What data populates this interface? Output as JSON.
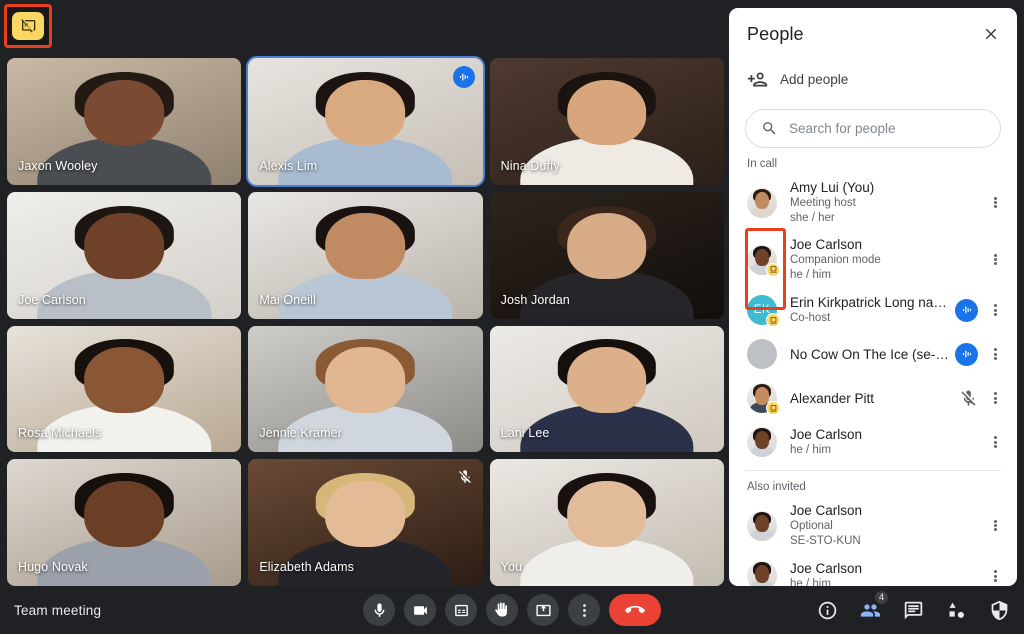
{
  "meeting": {
    "title": "Team meeting",
    "corner_badge_icon": "present-off-icon"
  },
  "grid": {
    "tiles": [
      {
        "name": "Jaxon Wooley",
        "speaking": false,
        "muted": false,
        "skin": "#7a4a33",
        "hair": "#241a14",
        "shirt": "#4a4d52",
        "bg1": "#c9b9a6",
        "bg2": "#8f8170"
      },
      {
        "name": "Alexis Lim",
        "speaking": true,
        "muted": false,
        "skin": "#d9a97f",
        "hair": "#1c1410",
        "shirt": "#a8bbd0",
        "bg1": "#e7e4df",
        "bg2": "#c5bfb5"
      },
      {
        "name": "Nina Duffy",
        "speaking": false,
        "muted": false,
        "skin": "#d7a67c",
        "hair": "#1b1310",
        "shirt": "#efeae4",
        "bg1": "#4e3a30",
        "bg2": "#2a1f19"
      },
      {
        "name": "Joe Carlson",
        "speaking": false,
        "muted": false,
        "skin": "#6e4128",
        "hair": "#1d1511",
        "shirt": "#b9bfc6",
        "bg1": "#efeeec",
        "bg2": "#d4d0c9"
      },
      {
        "name": "Mai Oneill",
        "speaking": false,
        "muted": false,
        "skin": "#c08b63",
        "hair": "#1a1210",
        "shirt": "#b9c6d4",
        "bg1": "#e9e7e3",
        "bg2": "#b9b4ab"
      },
      {
        "name": "Josh Jordan",
        "speaking": false,
        "muted": false,
        "skin": "#d8ab87",
        "hair": "#3a261a",
        "shirt": "#26262a",
        "bg1": "#2d241d",
        "bg2": "#120e0b"
      },
      {
        "name": "Rosa Michaels",
        "speaking": false,
        "muted": false,
        "skin": "#8a5736",
        "hair": "#17110d",
        "shirt": "#f2f1ee",
        "bg1": "#e6e2da",
        "bg2": "#b9a893"
      },
      {
        "name": "Jennie Kramer",
        "speaking": false,
        "muted": false,
        "skin": "#e0b693",
        "hair": "#8a5a34",
        "shirt": "#cfd6dd",
        "bg1": "#cfcdc9",
        "bg2": "#8d8b87"
      },
      {
        "name": "Lani Lee",
        "speaking": false,
        "muted": false,
        "skin": "#dcb08a",
        "hair": "#15100d",
        "shirt": "#2a3148",
        "bg1": "#eceae6",
        "bg2": "#cfc9c0"
      },
      {
        "name": "Hugo Novak",
        "speaking": false,
        "muted": false,
        "skin": "#6b3f26",
        "hair": "#15100c",
        "shirt": "#9aa1ab",
        "bg1": "#ddd8d1",
        "bg2": "#a89b8b"
      },
      {
        "name": "Elizabeth Adams",
        "speaking": false,
        "muted": true,
        "skin": "#e3bb97",
        "hair": "#d6b679",
        "shirt": "#24242a",
        "bg1": "#6a4a36",
        "bg2": "#2c1d14"
      },
      {
        "name": "You",
        "speaking": false,
        "muted": false,
        "skin": "#e2bc9a",
        "hair": "#191110",
        "shirt": "#f0eeea",
        "bg1": "#ebe8e3",
        "bg2": "#c3bcb1"
      }
    ]
  },
  "people_panel": {
    "title": "People",
    "close_label": "Close",
    "add_people_label": "Add people",
    "search": {
      "value": "",
      "placeholder": "Search for people"
    },
    "sections": [
      {
        "label": "In call",
        "people": [
          {
            "name": "Amy Lui (You)",
            "sub1": "Meeting host",
            "sub2": "she / her",
            "avatar_type": "photo",
            "skin": "#c08b63",
            "hair": "#2a1a12",
            "shirt": "#dcd6cd",
            "companion": false,
            "audio_active": false,
            "muted": false
          },
          {
            "name": "Joe Carlson",
            "sub1": "Companion mode",
            "sub2": "he / him",
            "avatar_type": "photo",
            "skin": "#6e4128",
            "hair": "#1d1511",
            "shirt": "#cfd3d8",
            "companion": true,
            "audio_active": false,
            "muted": false
          },
          {
            "name": "Erin Kirkpatrick Long nam…",
            "sub1": "Co-host",
            "sub2": "",
            "avatar_type": "initials",
            "initials": "EK",
            "avatar_color": "#3fbcd1",
            "companion": true,
            "audio_active": true,
            "muted": false
          },
          {
            "name": "No Cow On The Ice (se-sto…",
            "sub1": "",
            "sub2": "",
            "avatar_type": "blank",
            "avatar_color": "#bdc1c6",
            "companion": false,
            "audio_active": true,
            "muted": false
          },
          {
            "name": "Alexander Pitt",
            "sub1": "",
            "sub2": "",
            "avatar_type": "photo",
            "skin": "#c58a5d",
            "hair": "#2b1d15",
            "shirt": "#3c4a5c",
            "companion": true,
            "audio_active": false,
            "muted": true
          },
          {
            "name": "Joe Carlson",
            "sub1": "he / him",
            "sub2": "",
            "avatar_type": "photo",
            "skin": "#6e4128",
            "hair": "#1d1511",
            "shirt": "#cfd3d8",
            "companion": false,
            "audio_active": false,
            "muted": false
          }
        ]
      },
      {
        "label": "Also invited",
        "people": [
          {
            "name": "Joe Carlson",
            "sub1": "Optional",
            "sub2": "SE-STO-KUN",
            "avatar_type": "photo",
            "skin": "#6e4128",
            "hair": "#1d1511",
            "shirt": "#cfd3d8",
            "companion": false,
            "audio_active": false,
            "muted": false
          },
          {
            "name": "Joe Carlson",
            "sub1": "he / him",
            "sub2": "",
            "avatar_type": "photo",
            "skin": "#6e4128",
            "hair": "#1d1511",
            "shirt": "#cfd3d8",
            "companion": false,
            "audio_active": false,
            "muted": false
          }
        ]
      }
    ]
  },
  "bottom_bar": {
    "center_controls": [
      {
        "name": "microphone-button",
        "icon": "mic-icon"
      },
      {
        "name": "camera-button",
        "icon": "video-icon"
      },
      {
        "name": "captions-button",
        "icon": "captions-icon"
      },
      {
        "name": "raise-hand-button",
        "icon": "hand-icon"
      },
      {
        "name": "present-button",
        "icon": "present-icon"
      },
      {
        "name": "more-options-button",
        "icon": "more-vert-icon"
      },
      {
        "name": "leave-call-button",
        "icon": "hangup-icon"
      }
    ],
    "right_controls": [
      {
        "name": "meeting-details-button",
        "icon": "info-icon",
        "badge": ""
      },
      {
        "name": "people-button",
        "icon": "people-icon",
        "badge": "4",
        "active": true
      },
      {
        "name": "chat-button",
        "icon": "chat-icon",
        "badge": ""
      },
      {
        "name": "activities-button",
        "icon": "activities-icon",
        "badge": ""
      },
      {
        "name": "host-controls-button",
        "icon": "shield-icon",
        "badge": ""
      }
    ]
  },
  "colors": {
    "accent_blue": "#1a73e8",
    "speaking_border": "#4a7fd4",
    "highlight_red": "#e8401f",
    "companion_yellow": "#fcd663",
    "hangup_red": "#ea4335"
  }
}
